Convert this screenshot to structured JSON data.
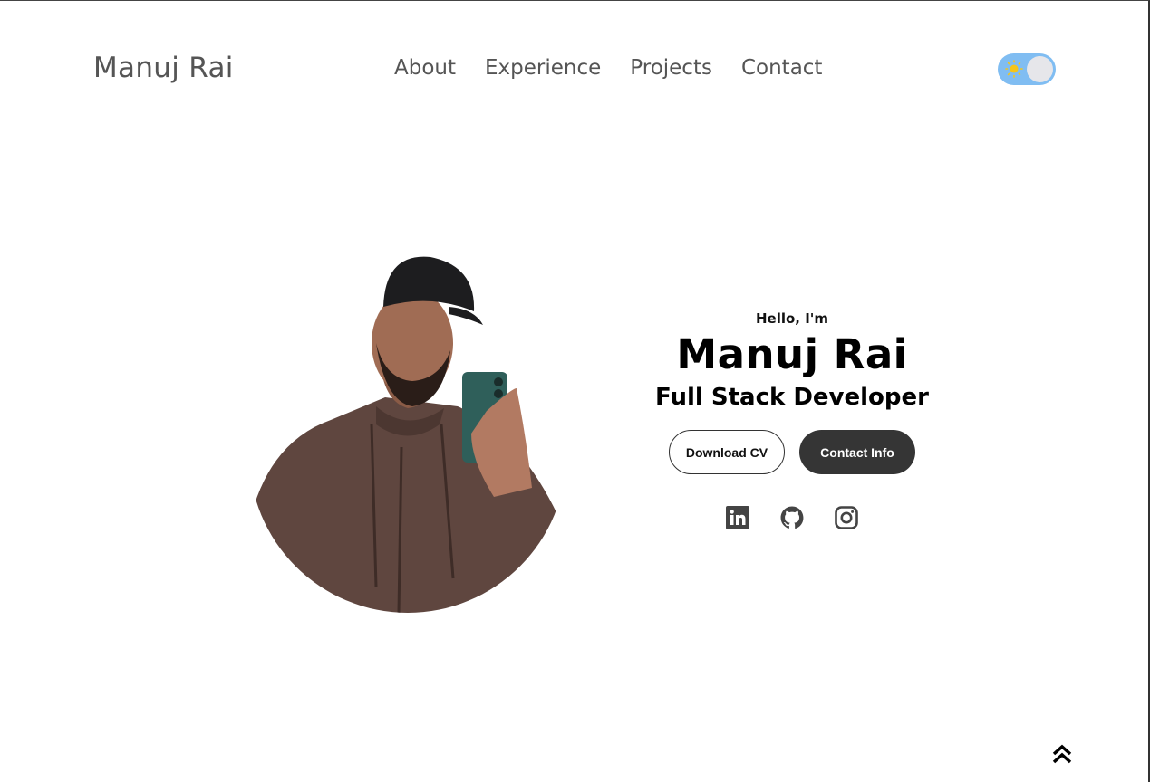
{
  "header": {
    "logo": "Manuj Rai",
    "nav": [
      {
        "label": "About"
      },
      {
        "label": "Experience"
      },
      {
        "label": "Projects"
      },
      {
        "label": "Contact"
      }
    ],
    "theme_toggle": {
      "icon": "sun-icon",
      "state": "light",
      "color": "#80bdf2"
    }
  },
  "hero": {
    "greeting": "Hello, I'm",
    "name": "Manuj Rai",
    "role": "Full Stack Developer",
    "buttons": {
      "download_cv": "Download CV",
      "contact_info": "Contact Info"
    },
    "socials": [
      {
        "icon": "linkedin-icon"
      },
      {
        "icon": "github-icon"
      },
      {
        "icon": "instagram-icon"
      }
    ]
  },
  "scroll_top": {
    "icon": "double-chevron-up-icon"
  }
}
